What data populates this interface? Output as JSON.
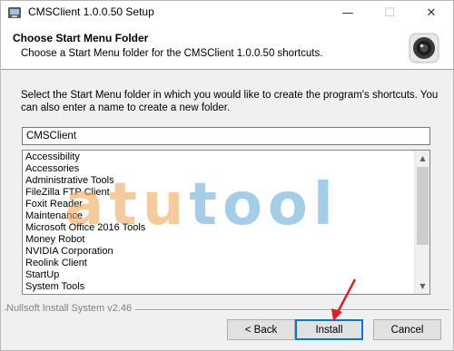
{
  "window": {
    "title": "CMSClient 1.0.0.50 Setup",
    "minimize_glyph": "—",
    "maximize_glyph": "☐",
    "close_glyph": "✕"
  },
  "header": {
    "title": "Choose Start Menu Folder",
    "subtitle": "Choose a Start Menu folder for the CMSClient 1.0.0.50 shortcuts."
  },
  "body": {
    "description": "Select the Start Menu folder in which you would like to create the program's shortcuts. You can also enter a name to create a new folder.",
    "folder_value": "CMSClient",
    "folders": [
      "Accessibility",
      "Accessories",
      "Administrative Tools",
      "FileZilla FTP Client",
      "Foxit Reader",
      "Maintenance",
      "Microsoft Office 2016 Tools",
      "Money Robot",
      "NVIDIA Corporation",
      "Reolink Client",
      "StartUp",
      "System Tools"
    ]
  },
  "watermark": {
    "part1": "atu",
    "part2": "tool"
  },
  "footer": {
    "branding": "Nullsoft Install System v2.46",
    "back_label": "< Back",
    "install_label": "Install",
    "cancel_label": "Cancel"
  },
  "colors": {
    "annotation_arrow": "#e02020",
    "default_button_border": "#0078d7"
  }
}
